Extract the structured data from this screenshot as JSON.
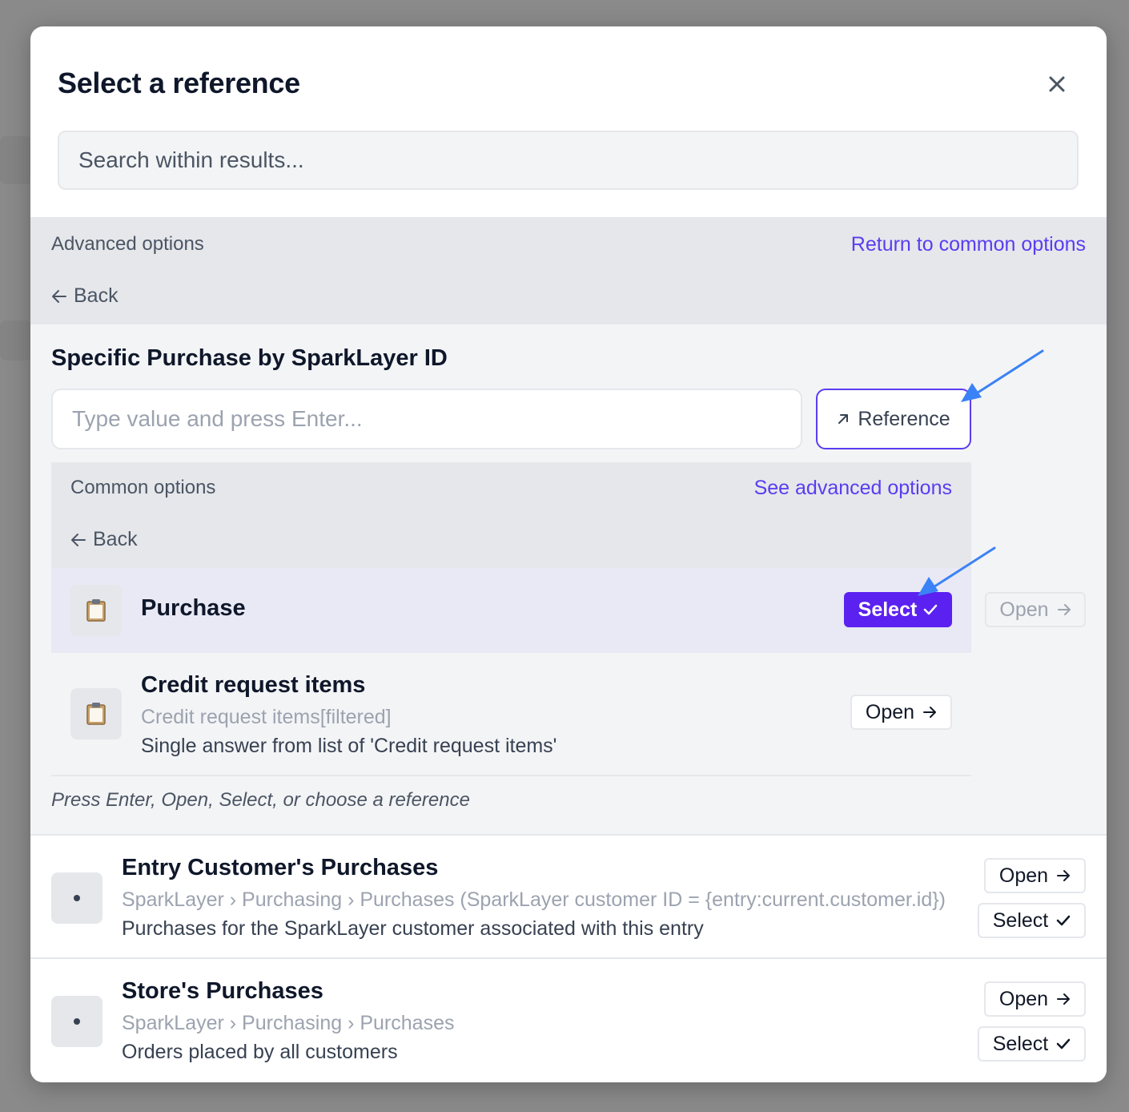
{
  "dialog": {
    "title": "Select a reference",
    "close_icon": "close-icon",
    "search_placeholder": "Search within results..."
  },
  "advanced": {
    "header_label": "Advanced options",
    "return_link": "Return to common options",
    "back_label": "Back",
    "field_title": "Specific Purchase by SparkLayer ID",
    "value_placeholder": "Type value and press Enter...",
    "reference_button": "Reference",
    "reference_icon": "arrow-up-right-icon",
    "floating_open": "Open",
    "hint": "Press Enter, Open, Select, or choose a reference"
  },
  "common": {
    "header_label": "Common options",
    "see_advanced_link": "See advanced options",
    "back_label": "Back",
    "items": [
      {
        "icon": "clipboard-icon",
        "title": "Purchase",
        "action_label": "Select",
        "selected": true
      },
      {
        "icon": "clipboard-icon",
        "title": "Credit request items",
        "path": "Credit request items[filtered]",
        "description": "Single answer from list of 'Credit request items'",
        "action_label": "Open"
      }
    ]
  },
  "results": [
    {
      "title": "Entry Customer's Purchases",
      "path": "SparkLayer › Purchasing › Purchases (SparkLayer customer ID = {entry:current.customer.id})",
      "description": "Purchases for the SparkLayer customer associated with this entry",
      "open_label": "Open",
      "select_label": "Select"
    },
    {
      "title": "Store's Purchases",
      "path": "SparkLayer › Purchasing › Purchases",
      "description": "Orders placed by all customers",
      "open_label": "Open",
      "select_label": "Select"
    }
  ],
  "colors": {
    "accent": "#5b21f0",
    "link": "#5b3cf0",
    "annotation_arrow": "#3b82f6"
  }
}
